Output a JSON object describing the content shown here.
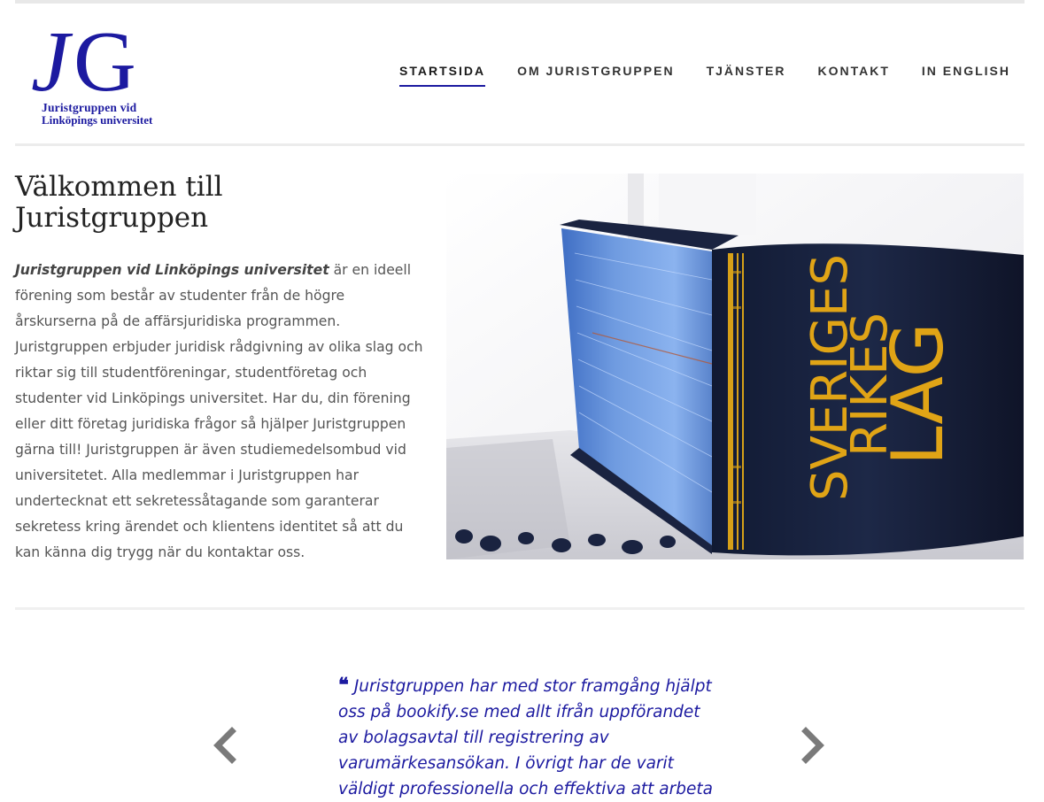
{
  "header": {
    "logo": {
      "initials": [
        "J",
        "G"
      ],
      "line1": "Juristgruppen vid",
      "line2": "Linköpings universitet"
    },
    "nav": [
      {
        "label": "STARTSIDA",
        "active": true
      },
      {
        "label": "OM JURISTGRUPPEN",
        "active": false
      },
      {
        "label": "TJÄNSTER",
        "active": false
      },
      {
        "label": "KONTAKT",
        "active": false
      },
      {
        "label": "IN ENGLISH",
        "active": false
      }
    ]
  },
  "main": {
    "title_line1": "Välkommen till",
    "title_line2": "Juristgruppen",
    "intro_bold": "Juristgruppen vid Linköpings universitet",
    "intro_rest": " är en ideell förening som består av studenter från de högre årskurserna på de affärsjuridiska programmen. Juristgruppen erbjuder juridisk rådgivning av olika slag och riktar sig till studentföreningar, studentföretag och studenter vid Linköpings universitet. Har du, din förening eller ditt företag juridiska frågor så hjälper Juristgruppen gärna till! Juristgruppen är även studiemedelsombud vid universitetet. Alla medlemmar i Juristgruppen har undertecknat ett sekretessåtagande som garanterar sekretess kring ärendet och klientens identitet så att du kan känna dig trygg när du kontaktar oss.",
    "hero_image": {
      "book_spine_text": [
        "SVERIGES",
        "RIKES",
        "LAG"
      ]
    }
  },
  "testimonial": {
    "quote_mark": "❝",
    "text": "Juristgruppen har med stor framgång hjälpt oss på bookify.se med allt ifrån uppförandet av bolagsavtal till registrering av varumärkesansökan. I övrigt har de varit väldigt professionella och effektiva att arbeta",
    "prev_icon": "chevron-left-icon",
    "next_icon": "chevron-right-icon"
  },
  "colors": {
    "brand": "#1c1aa0",
    "text": "#555555",
    "heading": "#222222"
  }
}
